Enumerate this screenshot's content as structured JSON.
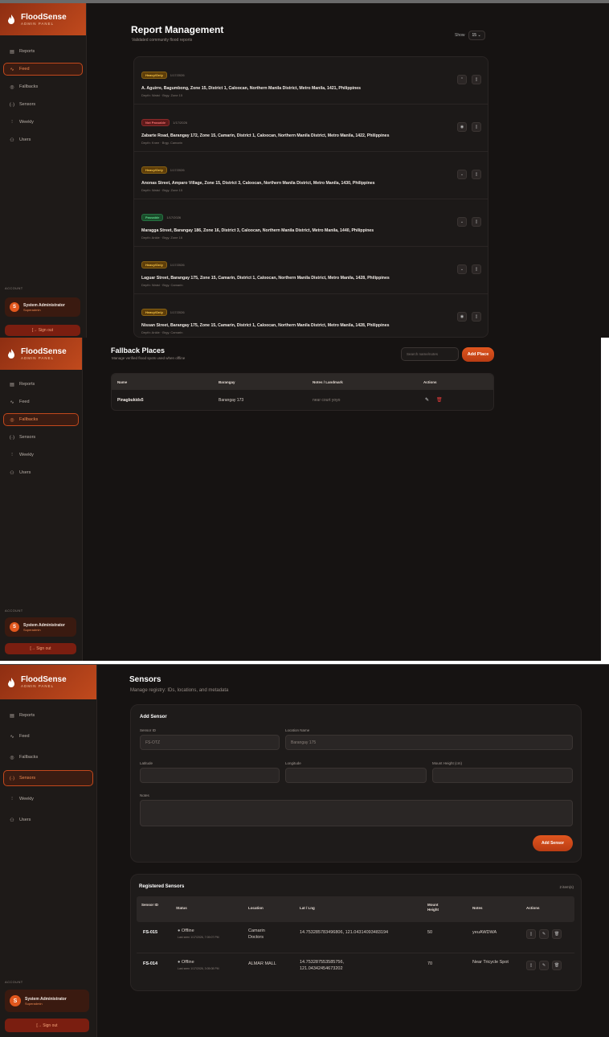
{
  "brand": {
    "name": "FloodSense",
    "tagline": "ADMIN PANEL"
  },
  "nav": [
    {
      "label": "Reports",
      "icon": "document-icon"
    },
    {
      "label": "Feed",
      "icon": "pulse-icon"
    },
    {
      "label": "Fallbacks",
      "icon": "pin-icon"
    },
    {
      "label": "Sensors",
      "icon": "signal-icon"
    },
    {
      "label": "Weekly",
      "icon": "bar-chart-icon"
    },
    {
      "label": "Users",
      "icon": "users-icon"
    }
  ],
  "account": {
    "section_label": "ACCOUNT",
    "initial": "S",
    "name": "System Administrator",
    "role": "Superadmin",
    "signout": "Sign out"
  },
  "feed": {
    "title": "Report Management",
    "subtitle": "Validated community flood reports",
    "show_label": "Show",
    "show_value": "15",
    "reports": [
      {
        "badge": "Heavy/Only",
        "badge_type": "heavy",
        "date": "1/17/2026",
        "address": "A. Aguirre, Bagumbong, Zone 15, District 1, Caloocan, Northern Manila District, Metro Manila, 1421, Philippines",
        "meta": "Depth: Waist · Brgy. Zone 15"
      },
      {
        "badge": "Not Passable",
        "badge_type": "kneedeep",
        "date": "1/17/2026",
        "address": "Zabarte Road, Barangay 172, Zone 15, Camarin, District 1, Caloocan, Northern Manila District, Metro Manila, 1422, Philippines",
        "meta": "Depth: Knee · Brgy. Camarin"
      },
      {
        "badge": "Heavy/Only",
        "badge_type": "heavy",
        "date": "1/17/2026",
        "address": "Anonas Street, Amparo Village, Zone 15, District 3, Caloocan, Northern Manila District, Metro Manila, 1430, Philippines",
        "meta": "Depth: Waist · Brgy. Zone 15"
      },
      {
        "badge": "Passable",
        "badge_type": "passable",
        "date": "1/17/2026",
        "address": "Maragga Street, Barangay 186, Zone 16, District 3, Caloocan, Northern Manila District, Metro Manila, 1440, Philippines",
        "meta": "Depth: Ankle · Brgy. Zone 16"
      },
      {
        "badge": "Heavy/Only",
        "badge_type": "heavy",
        "date": "1/17/2026",
        "address": "Laguar Street, Barangay 175, Zone 15, Camarin, District 1, Caloocan, Northern Manila District, Metro Manila, 1428, Philippines",
        "meta": "Depth: Waist · Brgy. Camarin"
      },
      {
        "badge": "Heavy/Only",
        "badge_type": "heavy",
        "date": "1/17/2026",
        "address": "Nissan Street, Barangay 175, Zone 15, Camarin, District 1, Caloocan, Northern Manila District, Metro Manila, 1428, Philippines",
        "meta": "Depth: Ankle · Brgy. Camarin"
      }
    ]
  },
  "fallbacks": {
    "title": "Fallback Places",
    "subtitle": "Manage verified flood spots used when offline",
    "search_placeholder": "Search name/notes",
    "add_button": "Add Place",
    "columns": [
      "Name",
      "Barangay",
      "Notes / Landmark",
      "Actions"
    ],
    "rows": [
      {
        "name": "Pinagbukids5",
        "barangay": "Barangay 173",
        "notes": "near court yoyo"
      }
    ]
  },
  "sensors": {
    "title": "Sensors",
    "subtitle": "Manage registry: IDs, locations, and metadata",
    "add_title": "Add Sensor",
    "labels": {
      "sensor_id": "Sensor ID",
      "location_name": "Location Name",
      "latitude": "Latitude",
      "longitude": "Longitude",
      "mount_height": "Mount Height (cm)",
      "notes": "Notes"
    },
    "values": {
      "sensor_id": "FS-OTZ",
      "location_name": "Barangay 175"
    },
    "add_button": "Add Sensor",
    "registered_title": "Registered Sensors",
    "count": "2 item(s)",
    "columns": [
      "Sensor ID",
      "Status",
      "Location",
      "Lat / Lng",
      "Mount Height",
      "Notes",
      "Actions"
    ],
    "rows": [
      {
        "id": "FS-015",
        "status": "Offline",
        "last_seen": "Last seen 1/17/2026, 7:09:07 PM",
        "location": "Camarin Doctors",
        "latlng": "14.753285783496806, 121.04314093483194",
        "mount": "50",
        "notes": "yeuAWDWA"
      },
      {
        "id": "FS-014",
        "status": "Offline",
        "last_seen": "Last seen 1/17/2026, 3:05:08 PM",
        "location": "ALMAR MALL",
        "latlng": "14.753287553585756, 121.04342454673202",
        "mount": "70",
        "notes": "Near Tricycle Spot"
      }
    ]
  },
  "colors": {
    "accent": "#e2571d",
    "background": "#161312",
    "sidebar": "#1e1a18"
  }
}
